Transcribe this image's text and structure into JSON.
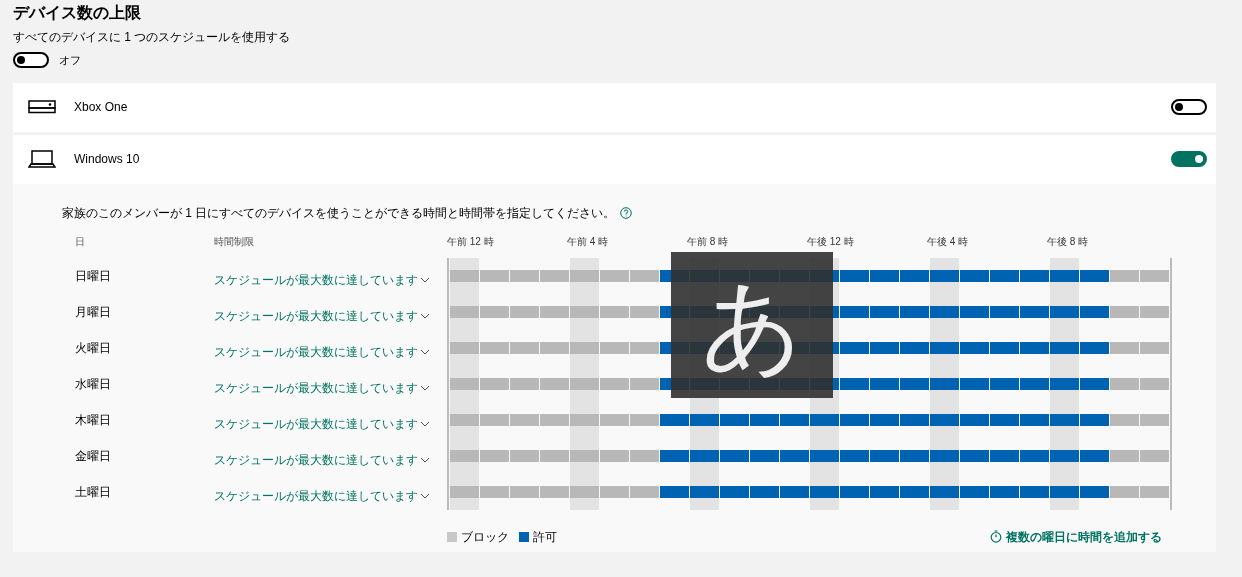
{
  "title": "デバイス数の上限",
  "one_schedule": {
    "label": "すべてのデバイスに 1 つのスケジュールを使用する",
    "on": false,
    "state_text": "オフ"
  },
  "devices": [
    {
      "kind": "console",
      "name": "Xbox One",
      "on": false
    },
    {
      "kind": "laptop",
      "name": "Windows 10",
      "on": true,
      "schedule": {
        "description": "家族のこのメンバーが 1 日にすべてのデバイスを使うことができる時間と時間帯を指定してください。",
        "columns": [
          "日",
          "時間制限"
        ],
        "hour_labels": [
          "午前 12 時",
          "午前 4 時",
          "午前 8 時",
          "午後 12 時",
          "午後 4 時",
          "午後 8 時"
        ],
        "days": [
          {
            "name": "日曜日",
            "limit": "スケジュールが最大数に達しています",
            "allowed": [
              false,
              false,
              false,
              false,
              false,
              false,
              false,
              true,
              true,
              true,
              true,
              true,
              true,
              true,
              true,
              true,
              true,
              true,
              true,
              true,
              true,
              true,
              false,
              false
            ]
          },
          {
            "name": "月曜日",
            "limit": "スケジュールが最大数に達しています",
            "allowed": [
              false,
              false,
              false,
              false,
              false,
              false,
              false,
              true,
              true,
              true,
              true,
              true,
              true,
              true,
              true,
              true,
              true,
              true,
              true,
              true,
              true,
              true,
              false,
              false
            ]
          },
          {
            "name": "火曜日",
            "limit": "スケジュールが最大数に達しています",
            "allowed": [
              false,
              false,
              false,
              false,
              false,
              false,
              false,
              true,
              true,
              true,
              true,
              true,
              true,
              true,
              true,
              true,
              true,
              true,
              true,
              true,
              true,
              true,
              false,
              false
            ]
          },
          {
            "name": "水曜日",
            "limit": "スケジュールが最大数に達しています",
            "allowed": [
              false,
              false,
              false,
              false,
              false,
              false,
              false,
              true,
              true,
              true,
              true,
              true,
              true,
              true,
              true,
              true,
              true,
              true,
              true,
              true,
              true,
              true,
              false,
              false
            ]
          },
          {
            "name": "木曜日",
            "limit": "スケジュールが最大数に達しています",
            "allowed": [
              false,
              false,
              false,
              false,
              false,
              false,
              false,
              true,
              true,
              true,
              true,
              true,
              true,
              true,
              true,
              true,
              true,
              true,
              true,
              true,
              true,
              true,
              false,
              false
            ]
          },
          {
            "name": "金曜日",
            "limit": "スケジュールが最大数に達しています",
            "allowed": [
              false,
              false,
              false,
              false,
              false,
              false,
              false,
              true,
              true,
              true,
              true,
              true,
              true,
              true,
              true,
              true,
              true,
              true,
              true,
              true,
              true,
              true,
              false,
              false
            ]
          },
          {
            "name": "土曜日",
            "limit": "スケジュールが最大数に達しています",
            "allowed": [
              false,
              false,
              false,
              false,
              false,
              false,
              false,
              true,
              true,
              true,
              true,
              true,
              true,
              true,
              true,
              true,
              true,
              true,
              true,
              true,
              true,
              true,
              false,
              false
            ]
          }
        ],
        "legend": {
          "blocked": "ブロック",
          "allowed": "許可"
        },
        "add_link": "複数の曜日に時間を追加する"
      }
    }
  ],
  "ime_indicator": "あ"
}
